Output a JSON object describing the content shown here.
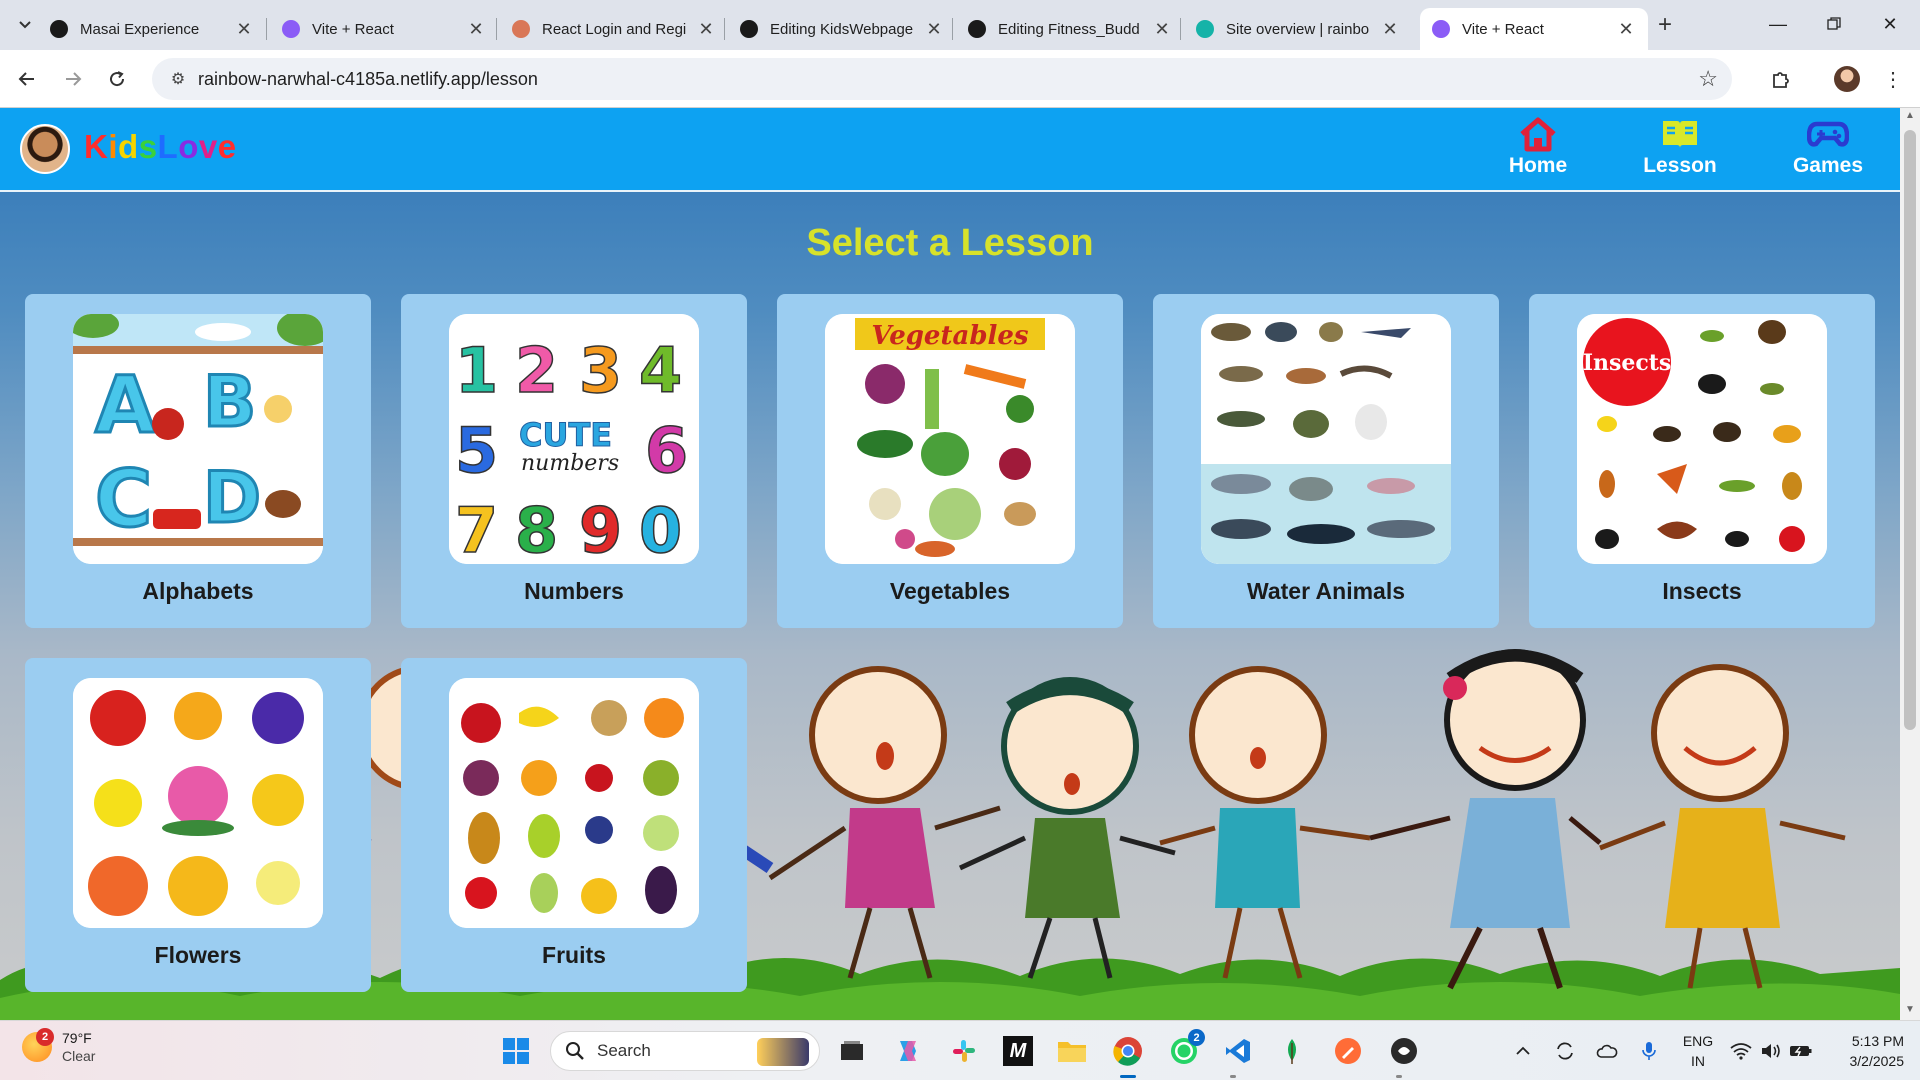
{
  "browser": {
    "tabs": [
      {
        "title": "Masai Experience",
        "icon": "masai-favicon",
        "color": "#1a1a1a",
        "active": false
      },
      {
        "title": "Vite + React",
        "icon": "vite-favicon",
        "color": "#8b5cf6",
        "active": false
      },
      {
        "title": "React Login and Regi",
        "icon": "claude-favicon",
        "color": "#d97757",
        "active": false
      },
      {
        "title": "Editing KidsWebpage",
        "icon": "github-favicon",
        "color": "#1a1a1a",
        "active": false
      },
      {
        "title": "Editing Fitness_Budd",
        "icon": "github-favicon",
        "color": "#1a1a1a",
        "active": false
      },
      {
        "title": "Site overview | rainbo",
        "icon": "netlify-favicon",
        "color": "#15b3a8",
        "active": false
      },
      {
        "title": "Vite + React",
        "icon": "vite-favicon",
        "color": "#8b5cf6",
        "active": true
      }
    ],
    "url": "rainbow-narwhal-c4185a.netlify.app/lesson"
  },
  "navbar": {
    "brand": "KidsLove",
    "brand_colors": [
      "#ff2d2d",
      "#ff8a00",
      "#f5d400",
      "#3ad13a",
      "#1e6cff",
      "#8a2be2",
      "#e0218a",
      "#ff2d2d"
    ],
    "items": [
      {
        "label": "Home",
        "icon": "home-icon",
        "color": "#e0213a"
      },
      {
        "label": "Lesson",
        "icon": "book-icon",
        "color": "#d9e82a"
      },
      {
        "label": "Games",
        "icon": "gamepad-icon",
        "color": "#2a3bd0"
      }
    ]
  },
  "page": {
    "title": "Select a Lesson",
    "title_color": "#d7e22a"
  },
  "lessons": [
    {
      "label": "Alphabets",
      "image": "abcd-letters-image"
    },
    {
      "label": "Numbers",
      "image": "cute-numbers-image"
    },
    {
      "label": "Vegetables",
      "image": "vegetables-chart-image"
    },
    {
      "label": "Water Animals",
      "image": "water-animals-chart-image"
    },
    {
      "label": "Insects",
      "image": "insects-chart-image"
    },
    {
      "label": "Flowers",
      "image": "flowers-chart-image"
    },
    {
      "label": "Fruits",
      "image": "fruits-chart-image"
    }
  ],
  "thumb_text": {
    "abcd": [
      "A",
      "B",
      "C",
      "D"
    ],
    "numbers": [
      "1",
      "2",
      "3",
      "4",
      "5",
      "6",
      "7",
      "8",
      "9",
      "0"
    ],
    "cute": "CUTE",
    "numbers_word": "numbers",
    "vegetables": "Vegetables",
    "insects": "Insects"
  },
  "taskbar": {
    "weather": {
      "temp": "79°F",
      "condition": "Clear",
      "badge": "2"
    },
    "search_placeholder": "Search",
    "whatsapp_badge": "2",
    "language": {
      "line1": "ENG",
      "line2": "IN"
    },
    "time": "5:13 PM",
    "date": "3/2/2025"
  }
}
